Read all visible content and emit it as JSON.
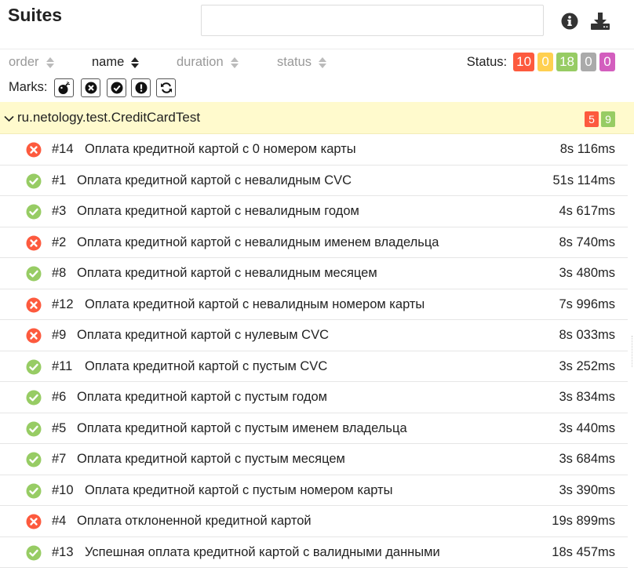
{
  "header": {
    "title": "Suites",
    "search_value": "",
    "info_icon": "info-icon",
    "download_icon": "download-icon"
  },
  "sort": {
    "order": "order",
    "name": "name",
    "duration": "duration",
    "status": "status",
    "active": "name"
  },
  "status_filter": {
    "label": "Status:",
    "counts": [
      {
        "value": "10",
        "kind": "failed",
        "color": "#fd5a3e"
      },
      {
        "value": "0",
        "kind": "broken",
        "color": "#ffd050"
      },
      {
        "value": "18",
        "kind": "passed",
        "color": "#97cc64"
      },
      {
        "value": "0",
        "kind": "skipped",
        "color": "#aaaaaa"
      },
      {
        "value": "0",
        "kind": "unknown",
        "color": "#d35ebe"
      }
    ]
  },
  "marks": {
    "label": "Marks:",
    "icons": [
      "bomb-icon",
      "times-circle-icon",
      "check-circle-icon",
      "exclamation-circle-icon",
      "refresh-icon"
    ]
  },
  "group": {
    "name": "ru.netology.test.CreditCardTest",
    "failed": "5",
    "passed": "9",
    "failed_color": "#fd5a3e",
    "passed_color": "#97cc64",
    "chevron_icon": "chevron-down-icon"
  },
  "colors": {
    "failed": "#fd5a3e",
    "passed": "#97cc64",
    "group_bg": "#fffacd"
  },
  "tests": [
    {
      "status": "failed",
      "uid": "#14",
      "name": "Оплата кредитной картой с 0 номером карты",
      "duration": "8s 116ms"
    },
    {
      "status": "passed",
      "uid": "#1",
      "name": "Оплата кредитной картой с невалидным CVC",
      "duration": "51s 114ms"
    },
    {
      "status": "passed",
      "uid": "#3",
      "name": "Оплата кредитной картой с невалидным годом",
      "duration": "4s 617ms"
    },
    {
      "status": "failed",
      "uid": "#2",
      "name": "Оплата кредитной картой с невалидным именем владельца",
      "duration": "8s 740ms"
    },
    {
      "status": "passed",
      "uid": "#8",
      "name": "Оплата кредитной картой с невалидным месяцем",
      "duration": "3s 480ms"
    },
    {
      "status": "failed",
      "uid": "#12",
      "name": "Оплата кредитной картой с невалидным номером карты",
      "duration": "7s 996ms"
    },
    {
      "status": "failed",
      "uid": "#9",
      "name": "Оплата кредитной картой с нулевым CVC",
      "duration": "8s 033ms"
    },
    {
      "status": "passed",
      "uid": "#11",
      "name": "Оплата кредитной картой с пустым CVC",
      "duration": "3s 252ms"
    },
    {
      "status": "passed",
      "uid": "#6",
      "name": "Оплата кредитной картой с пустым годом",
      "duration": "3s 834ms"
    },
    {
      "status": "passed",
      "uid": "#5",
      "name": "Оплата кредитной картой с пустым именем владельца",
      "duration": "3s 440ms"
    },
    {
      "status": "passed",
      "uid": "#7",
      "name": "Оплата кредитной картой с пустым месяцем",
      "duration": "3s 684ms"
    },
    {
      "status": "passed",
      "uid": "#10",
      "name": "Оплата кредитной картой с пустым номером карты",
      "duration": "3s 390ms"
    },
    {
      "status": "failed",
      "uid": "#4",
      "name": "Оплата отклоненной кредитной картой",
      "duration": "19s 899ms"
    },
    {
      "status": "passed",
      "uid": "#13",
      "name": "Успешная оплата кредитной картой с валидными данными",
      "duration": "18s 457ms"
    }
  ]
}
